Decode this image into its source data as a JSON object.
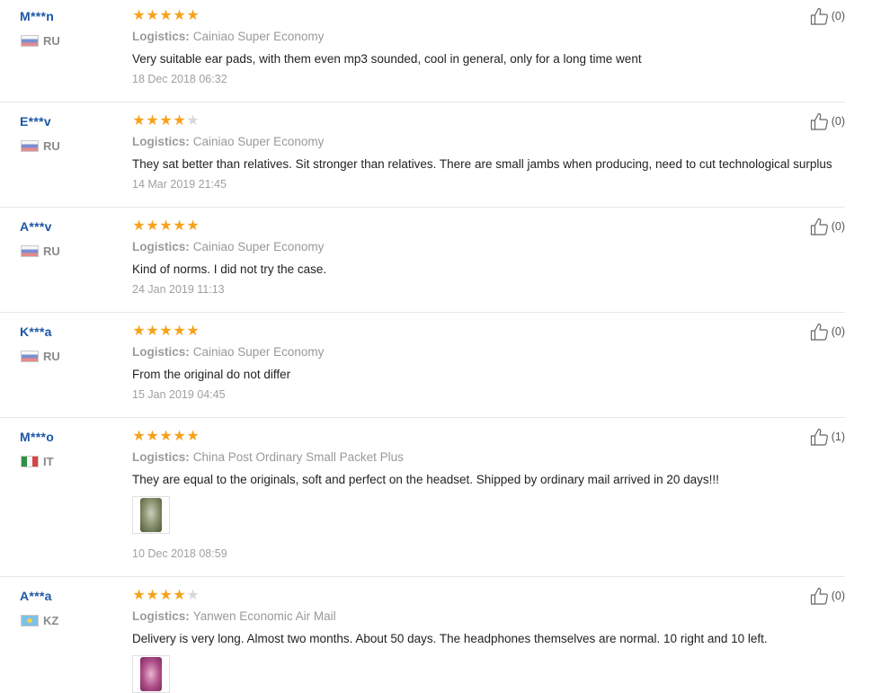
{
  "logistics_label": "Logistics:",
  "reviews": [
    {
      "user": "M***n",
      "country": "RU",
      "flag": "ru",
      "stars": 5,
      "logistics": "Cainiao Super Economy",
      "comment": "Very suitable ear pads, with them even mp3 sounded, cool in general, only for a long time went",
      "date": "18 Dec 2018 06:32",
      "helpful": "(0)"
    },
    {
      "user": "E***v",
      "country": "RU",
      "flag": "ru",
      "stars": 4,
      "logistics": "Cainiao Super Economy",
      "comment": "They sat better than relatives. Sit stronger than relatives. There are small jambs when producing, need to cut technological surplus",
      "date": "14 Mar 2019 21:45",
      "helpful": "(0)"
    },
    {
      "user": "A***v",
      "country": "RU",
      "flag": "ru",
      "stars": 5,
      "logistics": "Cainiao Super Economy",
      "comment": "Kind of norms. I did not try the case.",
      "date": "24 Jan 2019 11:13",
      "helpful": "(0)"
    },
    {
      "user": "K***a",
      "country": "RU",
      "flag": "ru",
      "stars": 5,
      "logistics": "Cainiao Super Economy",
      "comment": "From the original do not differ",
      "date": "15 Jan 2019 04:45",
      "helpful": "(0)"
    },
    {
      "user": "M***o",
      "country": "IT",
      "flag": "it",
      "stars": 5,
      "logistics": "China Post Ordinary Small Packet Plus",
      "comment": "They are equal to the originals, soft and perfect on the headset. Shipped by ordinary mail arrived in 20 days!!!",
      "date": "10 Dec 2018 08:59",
      "helpful": "(1)"
    },
    {
      "user": "A***a",
      "country": "KZ",
      "flag": "kz",
      "stars": 4,
      "logistics": "Yanwen Economic Air Mail",
      "comment": "Delivery is very long. Almost two months. About 50 days. The headphones themselves are normal. 10 right and 10 left.",
      "date": "",
      "helpful": "(0)"
    }
  ]
}
